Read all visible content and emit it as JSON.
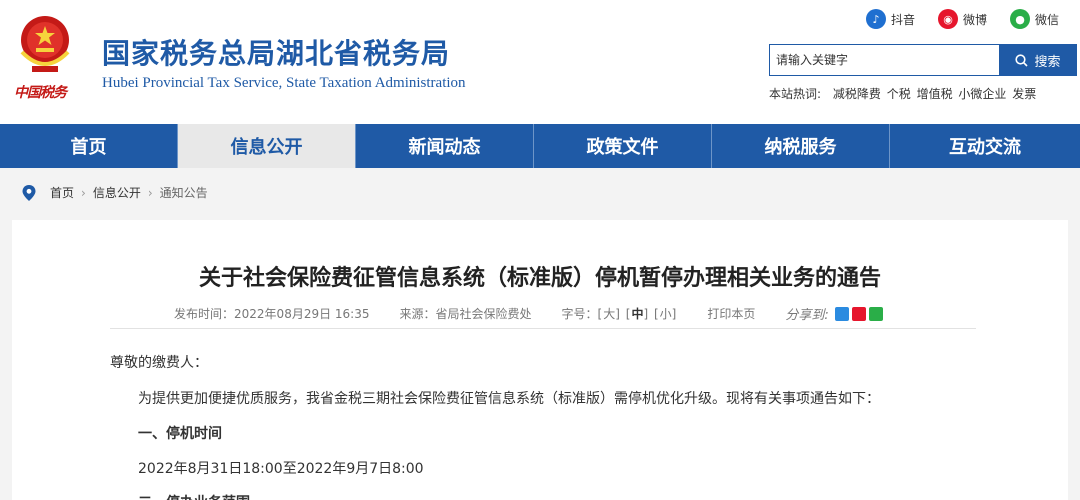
{
  "header": {
    "site_name_cn": "国家税务总局湖北省税务局",
    "site_name_en": "Hubei Provincial Tax Service, State Taxation Administration",
    "slogan": "中国税务",
    "social": [
      {
        "label": "抖音",
        "icon": "douyin-icon"
      },
      {
        "label": "微博",
        "icon": "weibo-icon"
      },
      {
        "label": "微信",
        "icon": "weixin-icon"
      }
    ],
    "search": {
      "placeholder": "请输入关键字",
      "button_label": "搜索"
    },
    "hotwords_label": "本站热词:",
    "hotwords": [
      "减税降费",
      "个税",
      "增值税",
      "小微企业",
      "发票"
    ]
  },
  "nav": {
    "items": [
      "首页",
      "信息公开",
      "新闻动态",
      "政策文件",
      "纳税服务",
      "互动交流"
    ],
    "active_index": 1
  },
  "breadcrumb": [
    "首页",
    "信息公开",
    "通知公告"
  ],
  "article": {
    "title": "关于社会保险费征管信息系统（标准版）停机暂停办理相关业务的通告",
    "publish_label": "发布时间：",
    "publish_time": "2022年08月29日 16:35",
    "source_label": "来源：",
    "source": "省局社会保险费处",
    "font_size_label": "字号：",
    "font_large": "大",
    "font_medium": "中",
    "font_small": "小",
    "print_label": "打印本页",
    "share_label": "分享到:",
    "paragraphs": [
      "尊敬的缴费人：",
      "为提供更加便捷优质服务，我省金税三期社会保险费征管信息系统（标准版）需停机优化升级。现将有关事项通告如下：",
      "一、停机时间",
      "2022年8月31日18:00至2022年9月7日8:00",
      "二、停办业务范围"
    ]
  },
  "colors": {
    "brand_blue": "#1f5aa6",
    "nav_active_bg": "#e8e8e8",
    "emblem_red": "#c41a17"
  }
}
